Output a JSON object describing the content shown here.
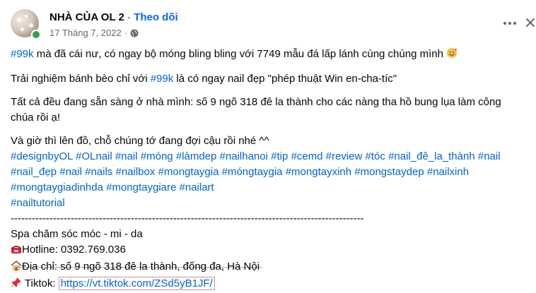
{
  "post": {
    "page_name": "NHÀ CỦA OL 2",
    "separator": "·",
    "follow_label": "Theo dõi",
    "date": "17 Tháng 7, 2022",
    "date_separator": "·",
    "privacy_icon": "globe-icon",
    "more_icon": "more-horizontal-icon",
    "close_icon": "close-icon"
  },
  "content": {
    "line1_tag": "#99k",
    "line1_text": " mà đã cái nư, có ngay bộ móng bling bling với 7749 mẫu đá lấp lánh cùng chúng mình ",
    "line1_emoji": "smiling-face-with-hearts-icon",
    "line2_pre": "Trải nghiệm bánh bèo chỉ với ",
    "line2_tag": "#99k",
    "line2_post": " là có ngay nail đẹp \"phép thuật Win en-cha-tíc\"",
    "line3": "Tất cả đều đang sẵn sàng ở nhà mình: số 9 ngõ 318 đê la thành cho các nàng tha hồ bung lụa làm công chúa rồi ạ!",
    "line4": "Và giờ thì lên đồ, chỗ chúng tớ đang đợi cậu rồi nhé ^^",
    "hashtags": [
      "#designbyOL",
      "#OLnail",
      "#nail",
      "#móng",
      "#làmdep",
      "#nailhanoi",
      "#tip",
      "#cemd",
      "#review",
      "#tóc",
      "#nail_đê_la_thành",
      "#nail",
      "#nail_đẹp",
      "#nail",
      "#nails",
      "#nailbox",
      "#mongtaygia",
      "#móngtaygia",
      "#mongtayxinh",
      "#mongstaydep",
      "#nailxinh",
      "#mongtaygiadinhda",
      "#mongtaygiare",
      "#nailart",
      "#nailtutorial"
    ],
    "divider": "----------------------------------------------------------------------------------------------------",
    "spa_line": " Spa chăm sóc móc - mi - da",
    "hotline_label": "Hotline: 0392.769.036",
    "address_label": " Địa chỉ: số 9 ngõ 318 đê la thành, đống đa, Hà Nội",
    "tiktok_label": " Tiktok: ",
    "tiktok_link": "https://vt.tiktok.com/ZSd5yB1JF/"
  }
}
